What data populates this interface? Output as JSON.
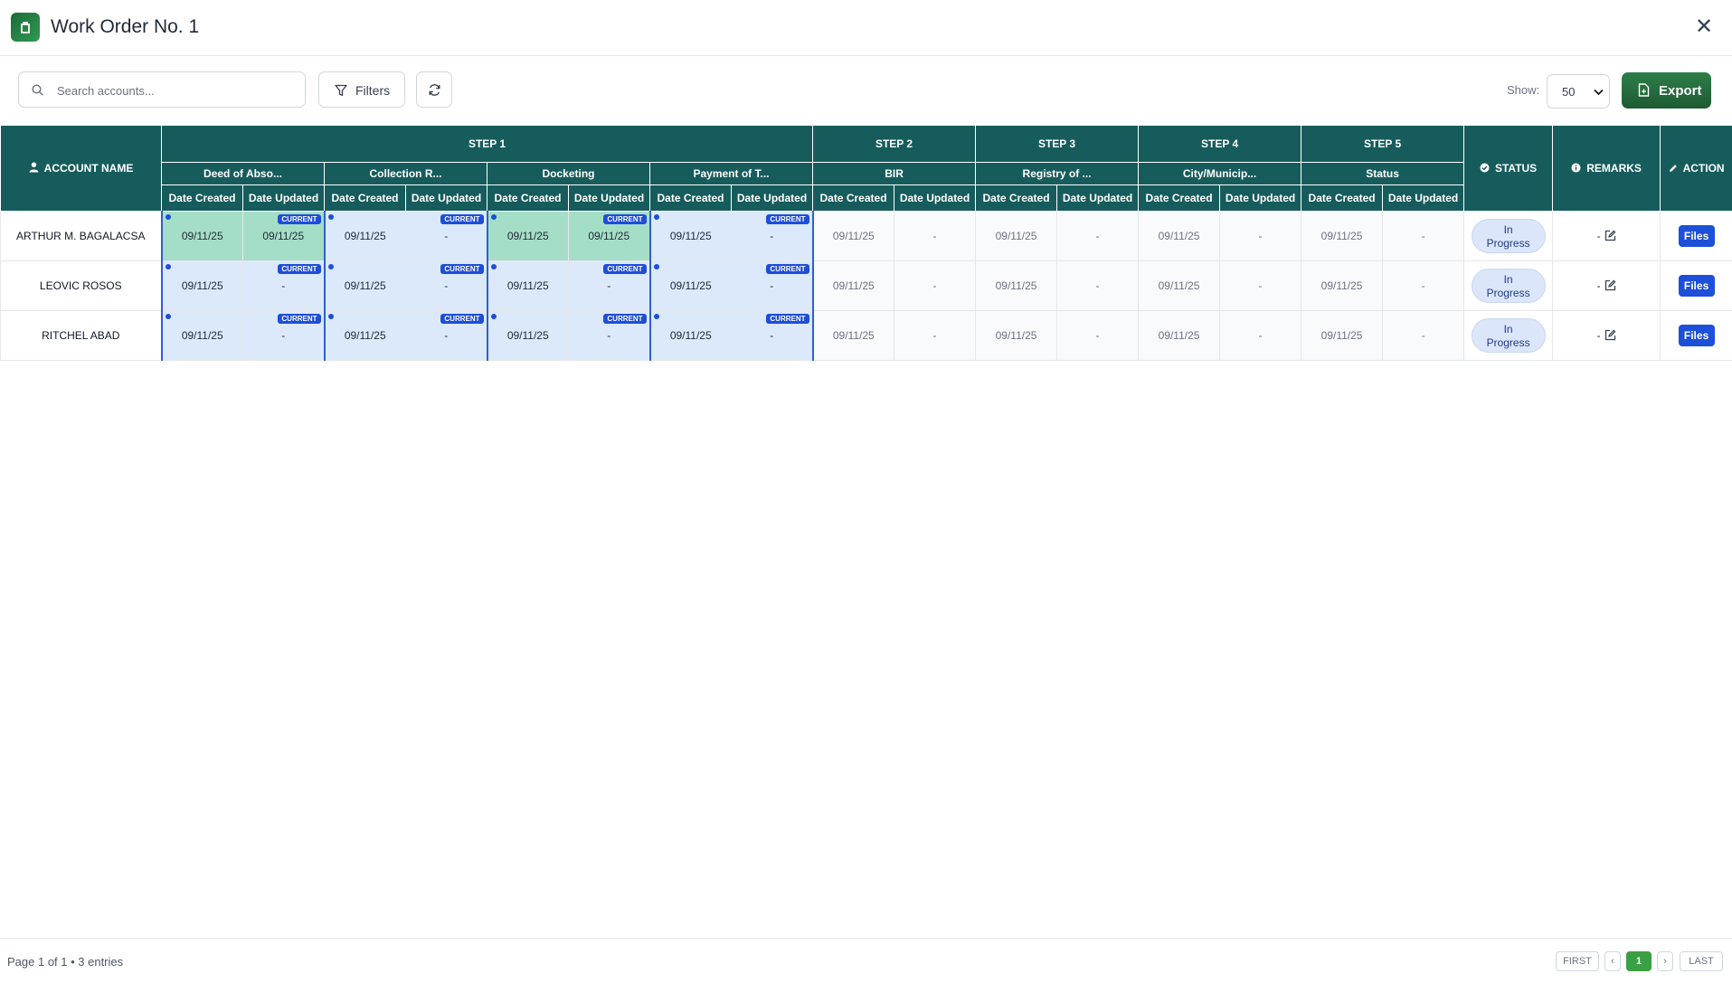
{
  "window": {
    "title": "Work Order No. 1",
    "close_symbol": "✕"
  },
  "toolbar": {
    "search_placeholder": "Search accounts...",
    "filters_label": "Filters",
    "show_label": "Show:",
    "show_value": "50",
    "export_label": "Export"
  },
  "table": {
    "account_header": "ACCOUNT NAME",
    "status_header": "STATUS",
    "remarks_header": "REMARKS",
    "action_header": "ACTION",
    "steps": [
      "STEP 1",
      "STEP 2",
      "STEP 3",
      "STEP 4",
      "STEP 5"
    ],
    "groups": [
      "Deed of Abso...",
      "Collection R...",
      "Docketing",
      "Payment of T...",
      "BIR",
      "Registry of ...",
      "City/Municip...",
      "Status"
    ],
    "date_created_label": "Date Created",
    "date_updated_label": "Date Updated",
    "current_badge": "CURRENT",
    "rows": [
      {
        "name": "ARTHUR M. BAGALACSA",
        "cells": [
          [
            "09/11/25",
            "09/11/25"
          ],
          [
            "09/11/25",
            "-"
          ],
          [
            "09/11/25",
            "09/11/25"
          ],
          [
            "09/11/25",
            "-"
          ],
          [
            "09/11/25",
            "-"
          ],
          [
            "09/11/25",
            "-"
          ],
          [
            "09/11/25",
            "-"
          ],
          [
            "09/11/25",
            "-"
          ]
        ],
        "status": "In Progress",
        "remarks": "-",
        "action": "Files"
      },
      {
        "name": "LEOVIC ROSOS",
        "cells": [
          [
            "09/11/25",
            "-"
          ],
          [
            "09/11/25",
            "-"
          ],
          [
            "09/11/25",
            "-"
          ],
          [
            "09/11/25",
            "-"
          ],
          [
            "09/11/25",
            "-"
          ],
          [
            "09/11/25",
            "-"
          ],
          [
            "09/11/25",
            "-"
          ],
          [
            "09/11/25",
            "-"
          ]
        ],
        "status": "In Progress",
        "remarks": "-",
        "action": "Files"
      },
      {
        "name": "RITCHEL ABAD",
        "cells": [
          [
            "09/11/25",
            "-"
          ],
          [
            "09/11/25",
            "-"
          ],
          [
            "09/11/25",
            "-"
          ],
          [
            "09/11/25",
            "-"
          ],
          [
            "09/11/25",
            "-"
          ],
          [
            "09/11/25",
            "-"
          ],
          [
            "09/11/25",
            "-"
          ],
          [
            "09/11/25",
            "-"
          ]
        ],
        "status": "In Progress",
        "remarks": "-",
        "action": "Files"
      }
    ]
  },
  "footer": {
    "page_info": "Page 1 of 1 • 3 entries",
    "first": "FIRST",
    "prev": "‹",
    "current_page": "1",
    "next": "›",
    "last": "LAST"
  },
  "colors": {
    "header_teal": "#175c5c",
    "current_blue": "#1d4ed8",
    "completed_green": "#a5dec6",
    "pending_blue": "#dbe9fb",
    "export_green": "#1e5a33",
    "page_active": "#3aa043"
  }
}
